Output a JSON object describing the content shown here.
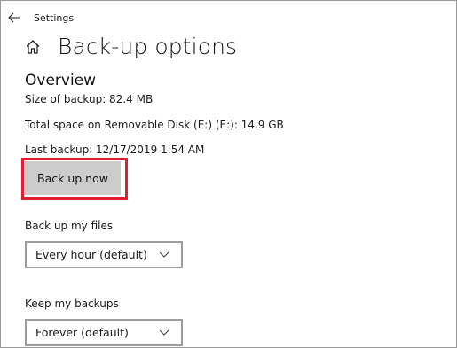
{
  "app": {
    "title": "Settings"
  },
  "header": {
    "title": "Back-up options"
  },
  "overview": {
    "heading": "Overview",
    "size_line": "Size of backup: 82.4 MB",
    "space_line": "Total space on Removable Disk (E:) (E:): 14.9 GB",
    "last_backup_line": "Last backup: 12/17/2019 1:54 AM",
    "backup_button": "Back up now"
  },
  "backup_frequency": {
    "label": "Back up my files",
    "selected": "Every hour (default)"
  },
  "retention": {
    "label": "Keep my backups",
    "selected": "Forever (default)"
  },
  "colors": {
    "highlight": "#e0202f",
    "button_bg": "#cccccc",
    "dropdown_border": "#9d9d9d"
  },
  "icons": {
    "back": "arrow-left-icon",
    "home": "home-icon",
    "dropdown": "chevron-down-icon"
  }
}
